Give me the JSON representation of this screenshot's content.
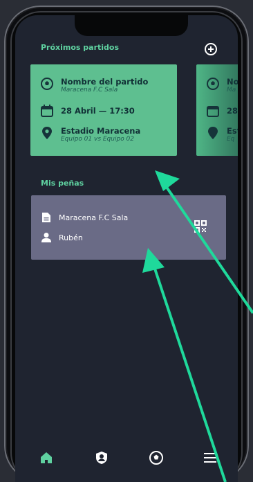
{
  "upcoming": {
    "title": "Próximos partidos",
    "add_icon": "plus-circle-icon",
    "cards": [
      {
        "match_name": "Nombre del partido",
        "match_team": "Maracena F.C Sala",
        "datetime": "28 Abril — 17:30",
        "venue": "Estadio Maracena",
        "teams": "Equipo 01 vs Equipo 02"
      },
      {
        "match_name": "No",
        "match_team": "Ma",
        "datetime": "28 A",
        "venue": "Est",
        "teams": "Eq"
      }
    ]
  },
  "penas": {
    "title": "Mis peñas",
    "items": [
      {
        "name": "Maracena F.C Sala",
        "user": "Rubén"
      }
    ]
  },
  "tabbar": {
    "items": [
      "home-icon",
      "shield-user-icon",
      "soccer-ball-icon",
      "menu-icon"
    ]
  },
  "colors": {
    "background": "#1f2430",
    "accent": "#5fd1a0",
    "card": "#5ebf90",
    "pena_card": "#6a6b86",
    "arrow": "#1fd99b"
  }
}
